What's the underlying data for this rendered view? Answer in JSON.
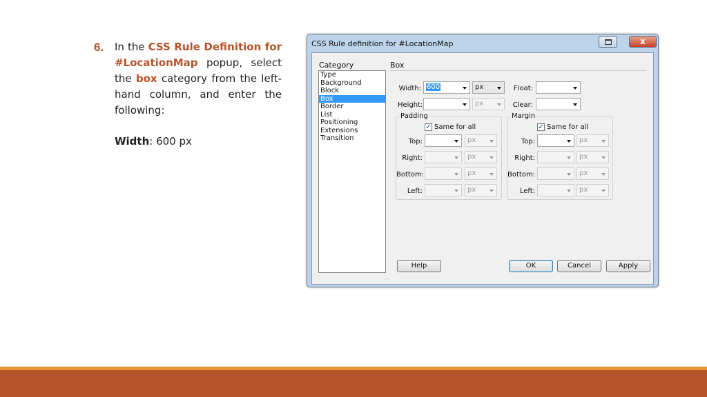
{
  "slide": {
    "step_number": "6.",
    "text_in_the": "In the",
    "text_rule_name": "CSS Rule Definition for #LocationMap",
    "text_popup_select": "popup, select the",
    "text_box": "box",
    "text_rest": "category from the left-hand column, and enter the following:",
    "width_label": "Width",
    "width_value": ": 600 px"
  },
  "dialog": {
    "title": "CSS Rule definition for #LocationMap",
    "close_glyph": "x",
    "category_label": "Category",
    "categories": [
      "Type",
      "Background",
      "Block",
      "Box",
      "Border",
      "List",
      "Positioning",
      "Extensions",
      "Transition"
    ],
    "selected_category": "Box",
    "panel_label": "Box",
    "width_label": "Width:",
    "width_value": "600",
    "width_unit": "px",
    "height_label": "Height:",
    "height_unit": "px",
    "float_label": "Float:",
    "clear_label": "Clear:",
    "padding": {
      "title": "Padding",
      "same_for_all": "Same for all",
      "top": "Top:",
      "right": "Right:",
      "bottom": "Bottom:",
      "left": "Left:",
      "unit": "px"
    },
    "margin": {
      "title": "Margin",
      "same_for_all": "Same for all",
      "top": "Top:",
      "right": "Right:",
      "bottom": "Bottom:",
      "left": "Left:",
      "unit": "px"
    },
    "buttons": {
      "help": "Help",
      "ok": "OK",
      "cancel": "Cancel",
      "apply": "Apply"
    }
  },
  "colors": {
    "accent": "#b5532a",
    "footer_bar": "#b6542b",
    "footer_line": "#e8952f",
    "selection": "#3399ff"
  }
}
